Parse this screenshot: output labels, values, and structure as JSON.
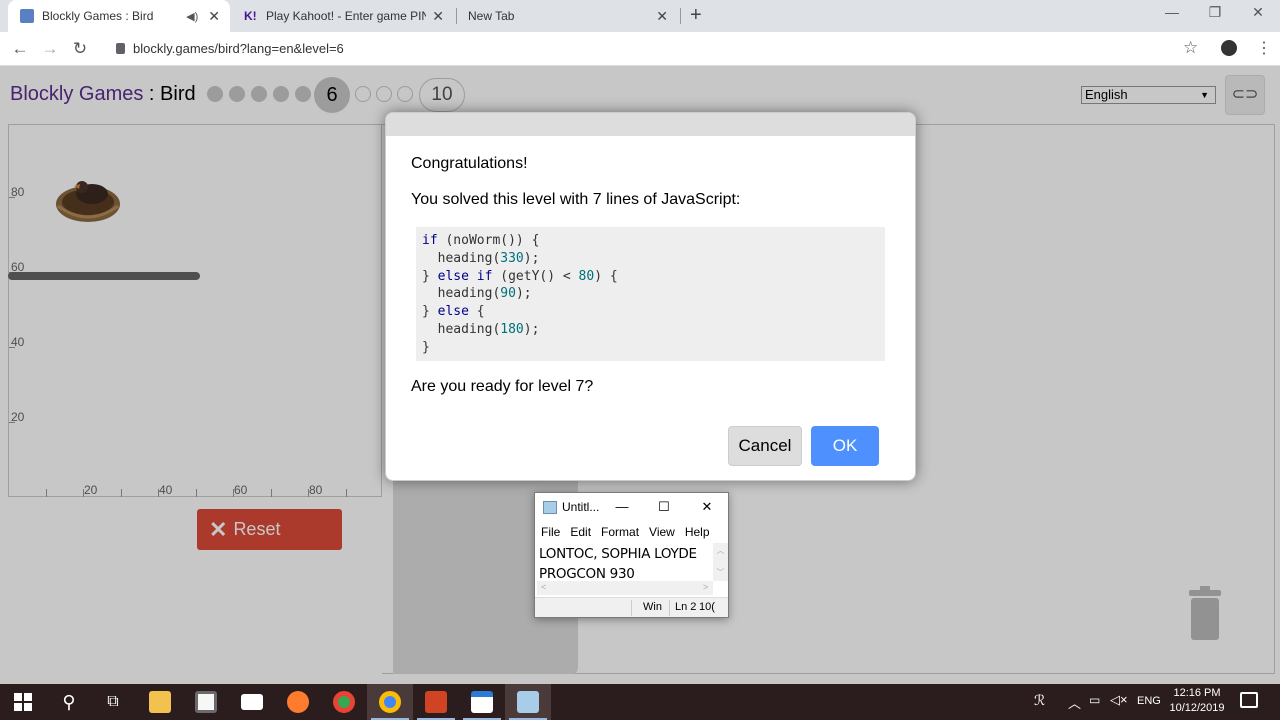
{
  "browser": {
    "tabs": [
      {
        "label": "Blockly Games : Bird",
        "active": true
      },
      {
        "label": "Play Kahoot! - Enter game PIN he",
        "active": false
      },
      {
        "label": "New Tab",
        "active": false
      }
    ],
    "new_tab_symbol": "+",
    "url": "blockly.games/bird?lang=en&level=6",
    "window_controls": [
      "—",
      "❐",
      "✕"
    ]
  },
  "app": {
    "title_link": "Blockly Games",
    "separator": " : ",
    "game_name": "Bird",
    "current_level": "6",
    "last_level": "10",
    "language": "English",
    "reset_label": "Reset"
  },
  "visualization": {
    "y_labels": [
      "80",
      "60",
      "40",
      "20"
    ],
    "x_labels": [
      "20",
      "40",
      "60",
      "80"
    ]
  },
  "dialog": {
    "title": "Congratulations!",
    "message": "You solved this level with 7 lines of JavaScript:",
    "question": "Are you ready for level 7?",
    "cancel_label": "Cancel",
    "ok_label": "OK"
  },
  "notepad": {
    "title": "Untitl...",
    "menu": [
      "File",
      "Edit",
      "Format",
      "View",
      "Help"
    ],
    "lines": [
      "LONTOC, SOPHIA LOYDE",
      "PROGCON 930"
    ],
    "status": [
      "Win",
      "Ln 2",
      "10("
    ]
  },
  "taskbar": {
    "language": "ENG",
    "time": "12:16 PM",
    "date": "10/12/2019"
  }
}
